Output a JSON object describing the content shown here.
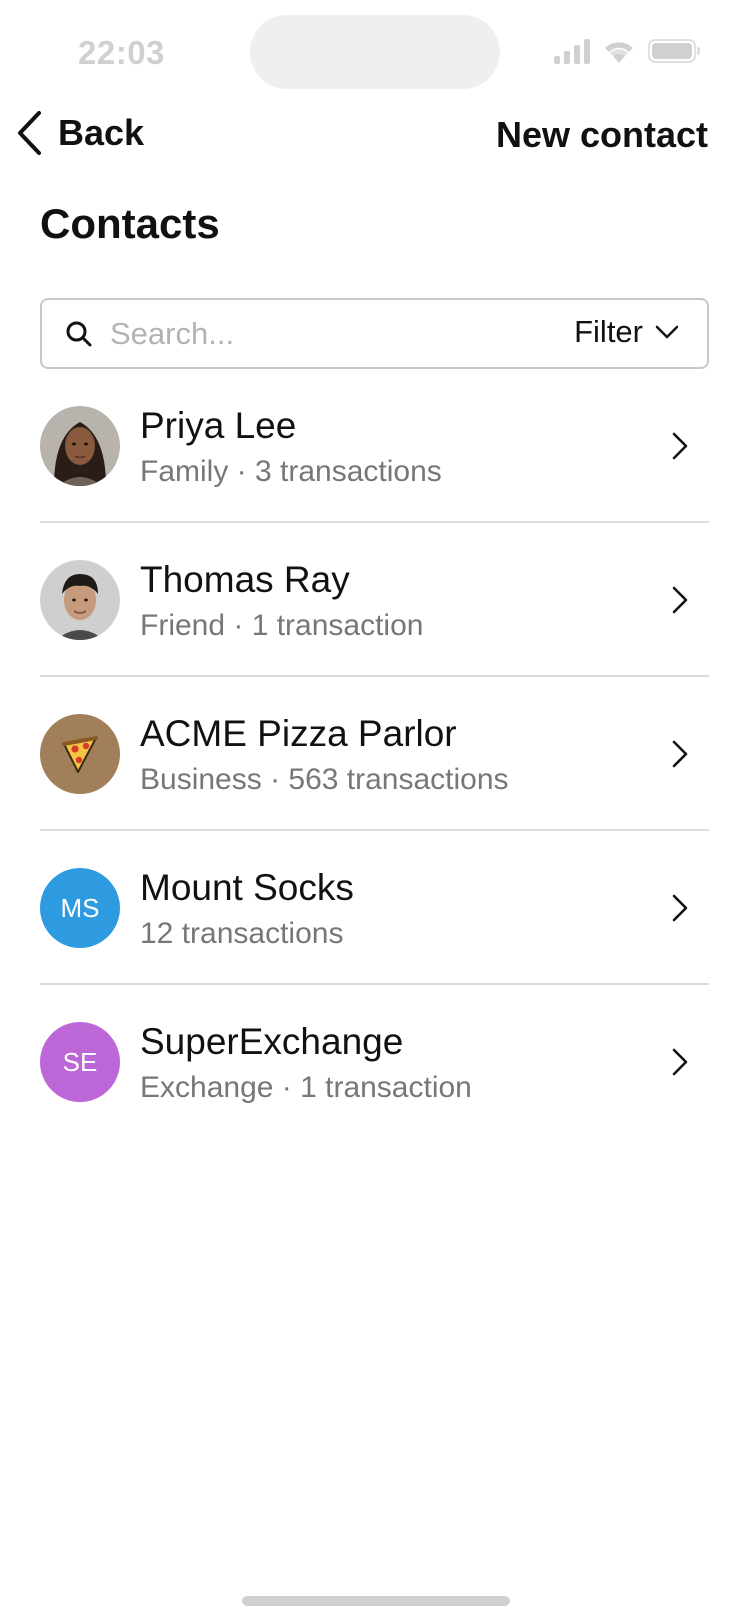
{
  "status_bar": {
    "time": "22:03",
    "icons": [
      "cellular-signal-icon",
      "wifi-icon",
      "battery-icon"
    ]
  },
  "nav": {
    "back_label": "Back",
    "new_contact_label": "New contact"
  },
  "page_title": "Contacts",
  "search": {
    "placeholder": "Search...",
    "value": "",
    "filter_label": "Filter"
  },
  "contacts": [
    {
      "name": "Priya Lee",
      "subtitle": "Family · 3 transactions",
      "avatar": "photo"
    },
    {
      "name": "Thomas Ray",
      "subtitle": "Friend · 1 transaction",
      "avatar": "photo"
    },
    {
      "name": "ACME Pizza Parlor",
      "subtitle": "Business · 563 transactions",
      "avatar": "pizza-icon",
      "avatar_color": "#a07f5a"
    },
    {
      "name": "Mount Socks",
      "subtitle": "12 transactions",
      "avatar_initials": "MS",
      "avatar_color": "#2e9be0"
    },
    {
      "name": "SuperExchange",
      "subtitle": "Exchange · 1 transaction",
      "avatar_initials": "SE",
      "avatar_color": "#bd66d8"
    }
  ],
  "colors": {
    "separator": "#dcdcdc",
    "secondary_text": "#777777",
    "status_gray": "#d0d0d0"
  }
}
